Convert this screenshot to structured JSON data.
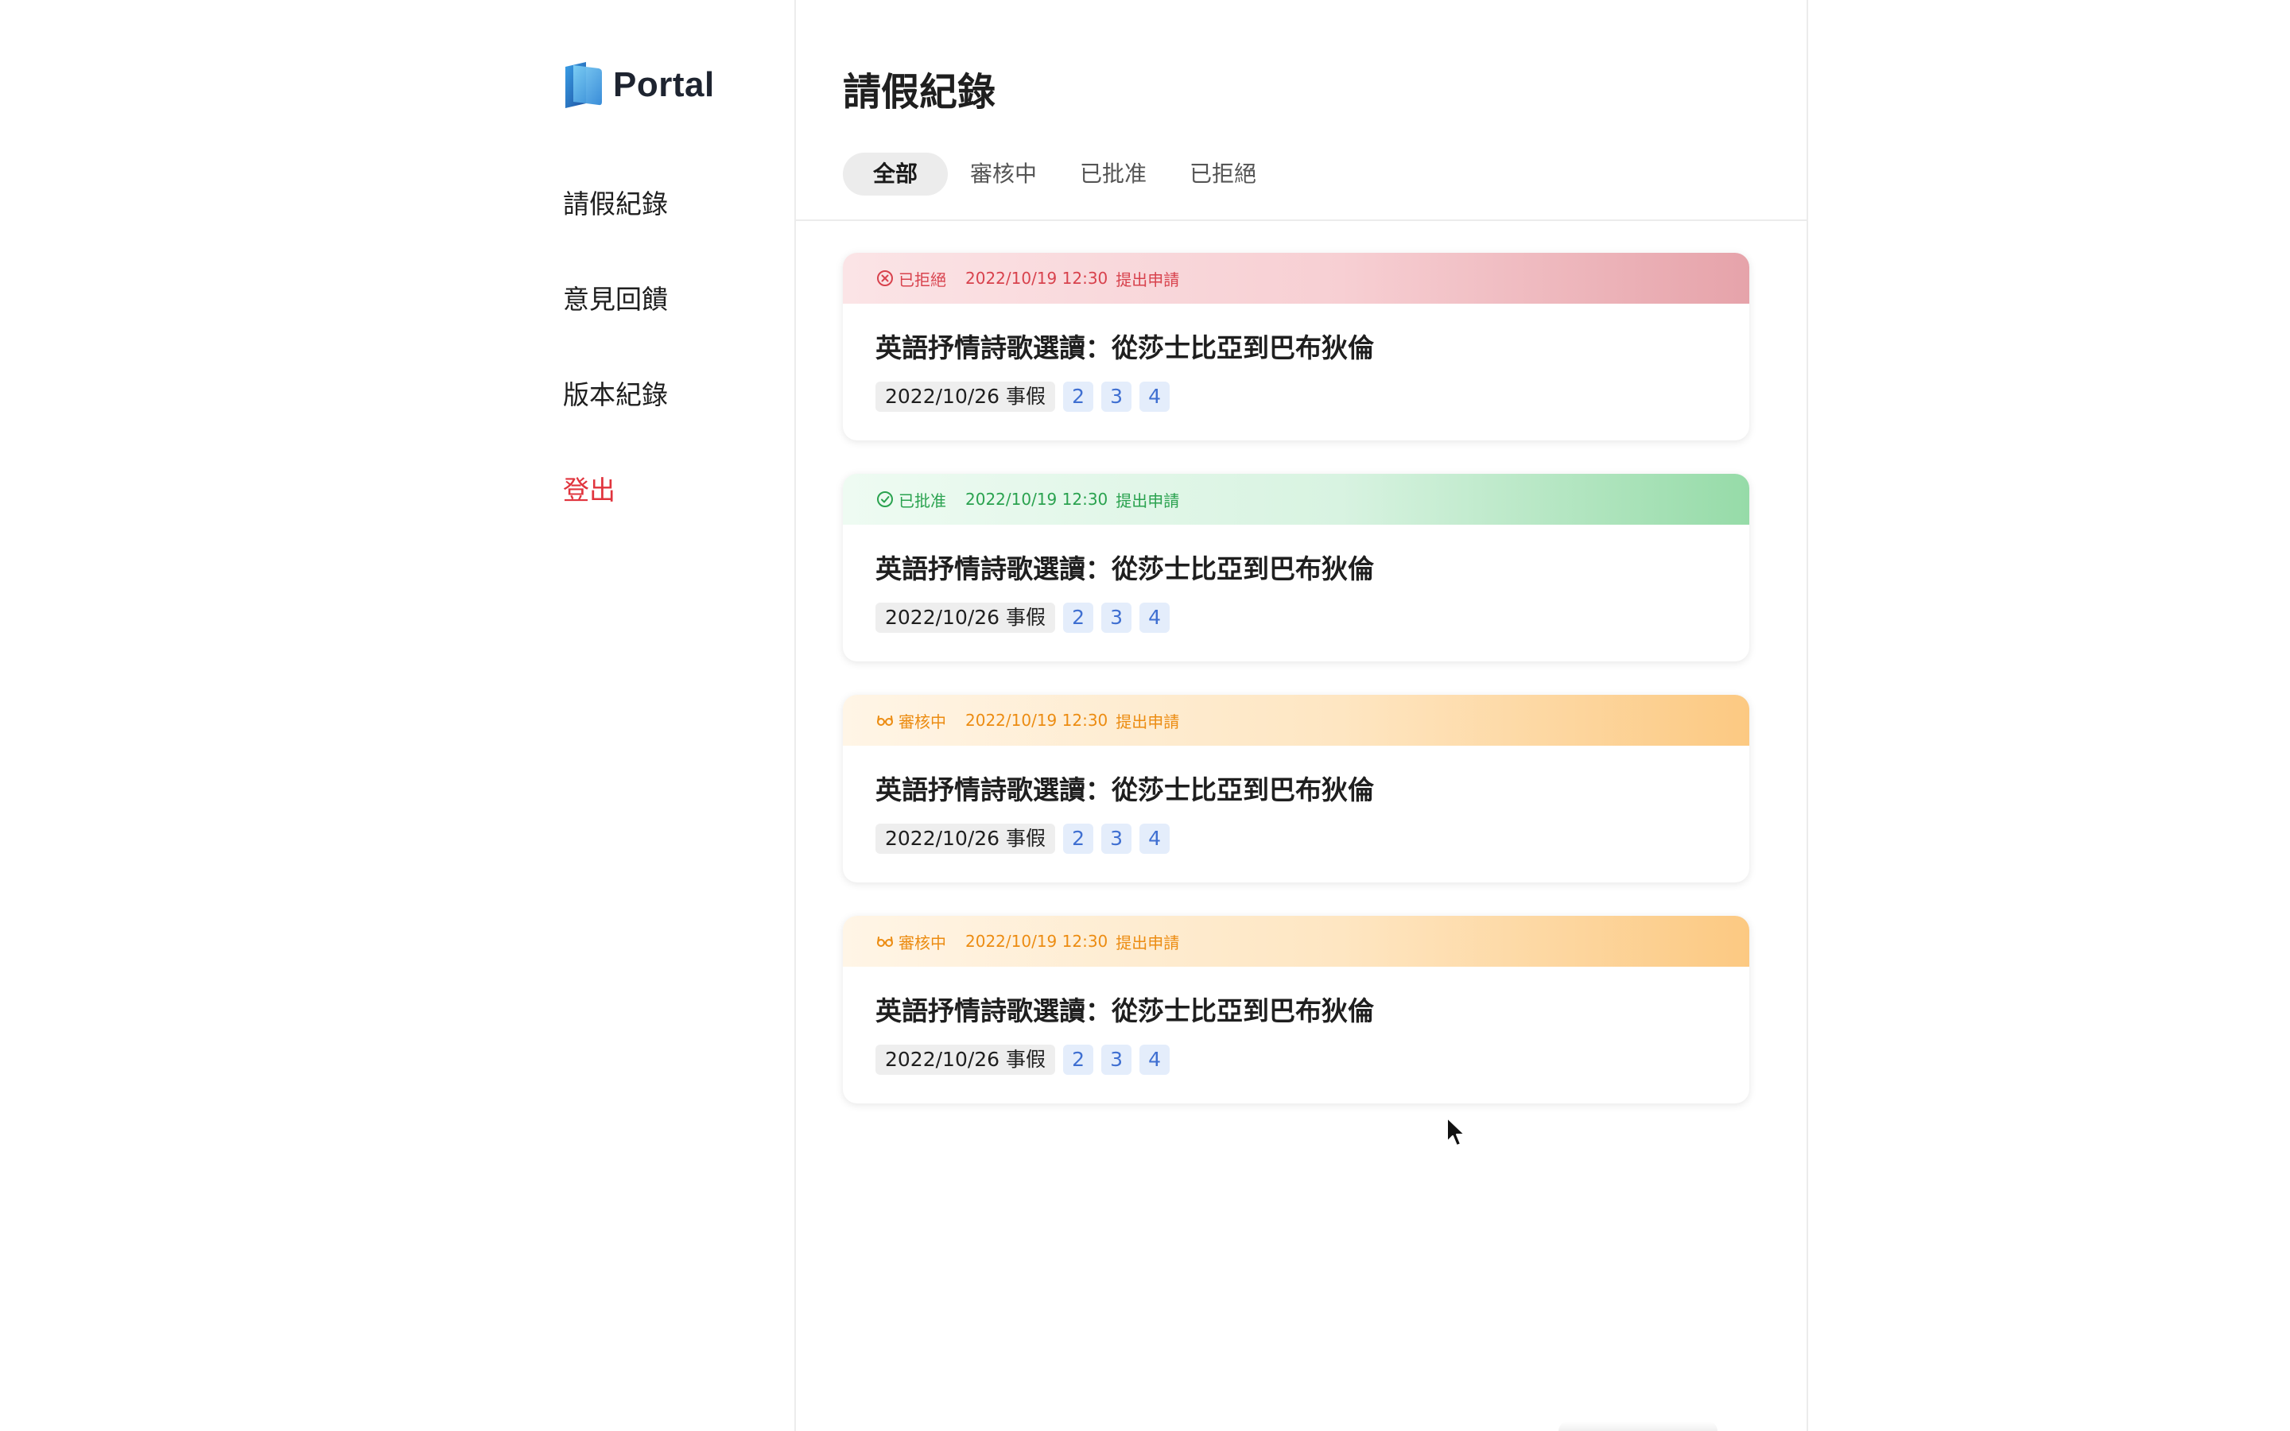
{
  "brand": {
    "name": "Portal",
    "logo_icon": "portal-logo-icon"
  },
  "sidebar": {
    "items": [
      {
        "label": "請假紀錄"
      },
      {
        "label": "意見回饋"
      },
      {
        "label": "版本紀錄"
      },
      {
        "label": "登出"
      }
    ]
  },
  "page": {
    "title": "請假紀錄"
  },
  "tabs": [
    {
      "label": "全部",
      "active": true
    },
    {
      "label": "審核中",
      "active": false
    },
    {
      "label": "已批准",
      "active": false
    },
    {
      "label": "已拒絕",
      "active": false
    }
  ],
  "colors": {
    "rejected": "#d8424d",
    "approved": "#2aa24f",
    "pending": "#ec8c12",
    "logout": "#e0343d",
    "period_tag": "#3f6fd1"
  },
  "records": [
    {
      "status": "rejected",
      "status_label": "已拒絕",
      "status_icon": "x-circle-icon",
      "submitted_at": "2022/10/19 12:30",
      "submit_text": "提出申請",
      "course": "英語抒情詩歌選讀：從莎士比亞到巴布狄倫",
      "leave_date_type": "2022/10/26 事假",
      "periods": [
        "2",
        "3",
        "4"
      ]
    },
    {
      "status": "approved",
      "status_label": "已批准",
      "status_icon": "check-circle-icon",
      "submitted_at": "2022/10/19 12:30",
      "submit_text": "提出申請",
      "course": "英語抒情詩歌選讀：從莎士比亞到巴布狄倫",
      "leave_date_type": "2022/10/26 事假",
      "periods": [
        "2",
        "3",
        "4"
      ]
    },
    {
      "status": "pending",
      "status_label": "審核中",
      "status_icon": "glasses-icon",
      "submitted_at": "2022/10/19 12:30",
      "submit_text": "提出申請",
      "course": "英語抒情詩歌選讀：從莎士比亞到巴布狄倫",
      "leave_date_type": "2022/10/26 事假",
      "periods": [
        "2",
        "3",
        "4"
      ]
    },
    {
      "status": "pending",
      "status_label": "審核中",
      "status_icon": "glasses-icon",
      "submitted_at": "2022/10/19 12:30",
      "submit_text": "提出申請",
      "course": "英語抒情詩歌選讀：從莎士比亞到巴布狄倫",
      "leave_date_type": "2022/10/26 事假",
      "periods": [
        "2",
        "3",
        "4"
      ]
    }
  ]
}
